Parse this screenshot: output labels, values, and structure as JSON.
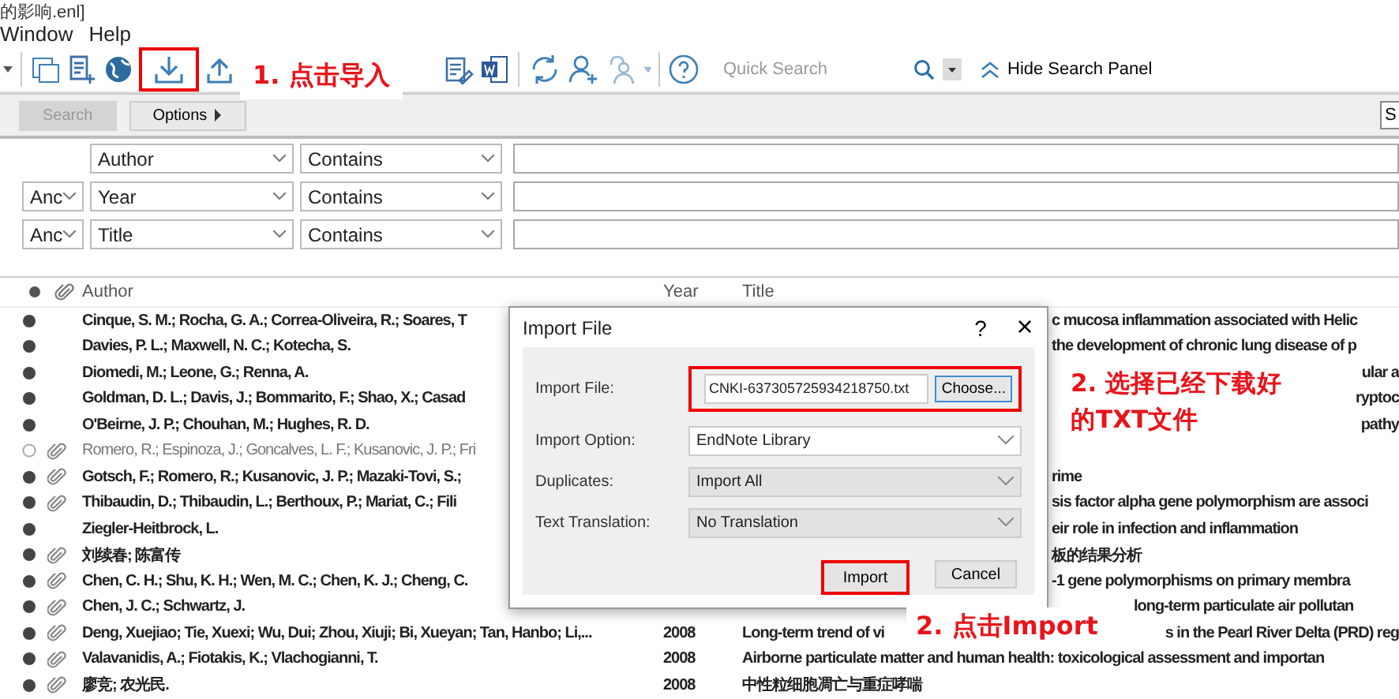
{
  "window": {
    "title": "的影响.enl]"
  },
  "menu": [
    "Window",
    "Help"
  ],
  "toolbar": {
    "import_highlighted": true,
    "quick_search": {
      "placeholder": "Quick Search"
    },
    "hide_panel": "Hide Search Panel"
  },
  "search_panel": {
    "search_button": {
      "label": "Search",
      "disabled": true
    },
    "options_button": "Options",
    "cut_button": "S",
    "rows": [
      {
        "connector": "",
        "field": "Author",
        "operator": "Contains"
      },
      {
        "connector": "Anc",
        "field": "Year",
        "operator": "Contains"
      },
      {
        "connector": "Anc",
        "field": "Title",
        "operator": "Contains"
      }
    ]
  },
  "table": {
    "columns": [
      "Author",
      "Year",
      "Title"
    ],
    "rows": [
      {
        "read": false,
        "attachment": false,
        "author": "Cinque, S. M.; Rocha, G. A.; Correa-Oliveira, R.; Soares, T",
        "year": "",
        "title": [
          "c mucosa inflammation associated with Helic"
        ]
      },
      {
        "read": false,
        "attachment": false,
        "author": "Davies, P. L.; Maxwell, N. C.; Kotecha, S.",
        "year": "",
        "title": [
          "the development of chronic lung disease of p"
        ]
      },
      {
        "read": false,
        "attachment": false,
        "author": "Diomedi, M.; Leone, G.; Renna, A.",
        "year": "",
        "title": [
          "ular a"
        ]
      },
      {
        "read": false,
        "attachment": false,
        "author": "Goldman, D. L.; Davis, J.; Bommarito, F.; Shao, X.; Casad",
        "year": "",
        "title": [
          "ryptoc"
        ]
      },
      {
        "read": false,
        "attachment": false,
        "author": "O'Beirne, J. P.; Chouhan, M.; Hughes, R. D.",
        "year": "",
        "title": [
          "pathy"
        ]
      },
      {
        "read": true,
        "attachment": true,
        "author": "Romero, R.; Espinoza, J.; Goncalves, L. F.; Kusanovic, J. P.; Fri",
        "year": "",
        "title": []
      },
      {
        "read": false,
        "attachment": true,
        "author": "Gotsch, F.; Romero, R.; Kusanovic, J. P.; Mazaki-Tovi, S.;",
        "year": "",
        "title": [
          "rime"
        ]
      },
      {
        "read": false,
        "attachment": true,
        "author": "Thibaudin, D.; Thibaudin, L.; Berthoux, P.; Mariat, C.; Fili",
        "year": "",
        "title": [
          "sis factor alpha gene polymorphism are associ"
        ]
      },
      {
        "read": false,
        "attachment": false,
        "author": "Ziegler-Heitbrock, L.",
        "year": "",
        "title": [
          "eir role in infection and inflammation"
        ]
      },
      {
        "read": false,
        "attachment": true,
        "author": "刘续春; 陈富传",
        "year": "",
        "title": [
          "板的结果分析"
        ]
      },
      {
        "read": false,
        "attachment": true,
        "author": "Chen, C. H.; Shu, K. H.; Wen, M. C.; Chen, K. J.; Cheng, C.",
        "year": "",
        "title": [
          "-1 gene polymorphisms on primary membra"
        ]
      },
      {
        "read": false,
        "attachment": true,
        "author": "Chen, J. C.; Schwartz, J.",
        "year": "",
        "title": [
          "long-term particulate air pollutan"
        ]
      },
      {
        "read": false,
        "attachment": true,
        "author": "Deng, Xuejiao; Tie, Xuexi; Wu, Dui; Zhou, Xiuji; Bi, Xueyan; Tan, Hanbo; Li,...",
        "year": "2008",
        "title": [
          "Long-term trend of vi",
          "s in the Pearl River Delta (PRD) reg"
        ]
      },
      {
        "read": false,
        "attachment": true,
        "author": "Valavanidis, A.; Fiotakis, K.; Vlachogianni, T.",
        "year": "2008",
        "title": [
          "Airborne particulate matter and human health: toxicological assessment and importan"
        ]
      },
      {
        "read": false,
        "attachment": true,
        "author": "廖竞; 农光民.",
        "year": "2008",
        "title": [
          "中性粒细胞凋亡与重症哮喘"
        ]
      }
    ]
  },
  "dialog": {
    "title": "Import File",
    "help": "?",
    "close": "×",
    "fields": [
      {
        "kind": "file",
        "label": "Import File:",
        "value": "CNKI-637305725934218750.txt",
        "button": "Choose...",
        "highlighted": true
      },
      {
        "kind": "select",
        "label": "Import Option:",
        "value": "EndNote Library",
        "disabled": false
      },
      {
        "kind": "select",
        "label": "Duplicates:",
        "value": "Import All",
        "disabled": true
      },
      {
        "kind": "select",
        "label": "Text Translation:",
        "value": "No Translation",
        "disabled": true
      }
    ],
    "buttons": [
      {
        "label": "Import",
        "highlighted": true
      },
      {
        "label": "Cancel",
        "highlighted": false
      }
    ]
  },
  "annotations": [
    {
      "kind": "step1",
      "text": "1. 点击导入"
    },
    {
      "kind": "step2",
      "text": "2. 选择已经下载好的TXT文件"
    },
    {
      "kind": "step3",
      "text": "2. 点击Import"
    }
  ]
}
